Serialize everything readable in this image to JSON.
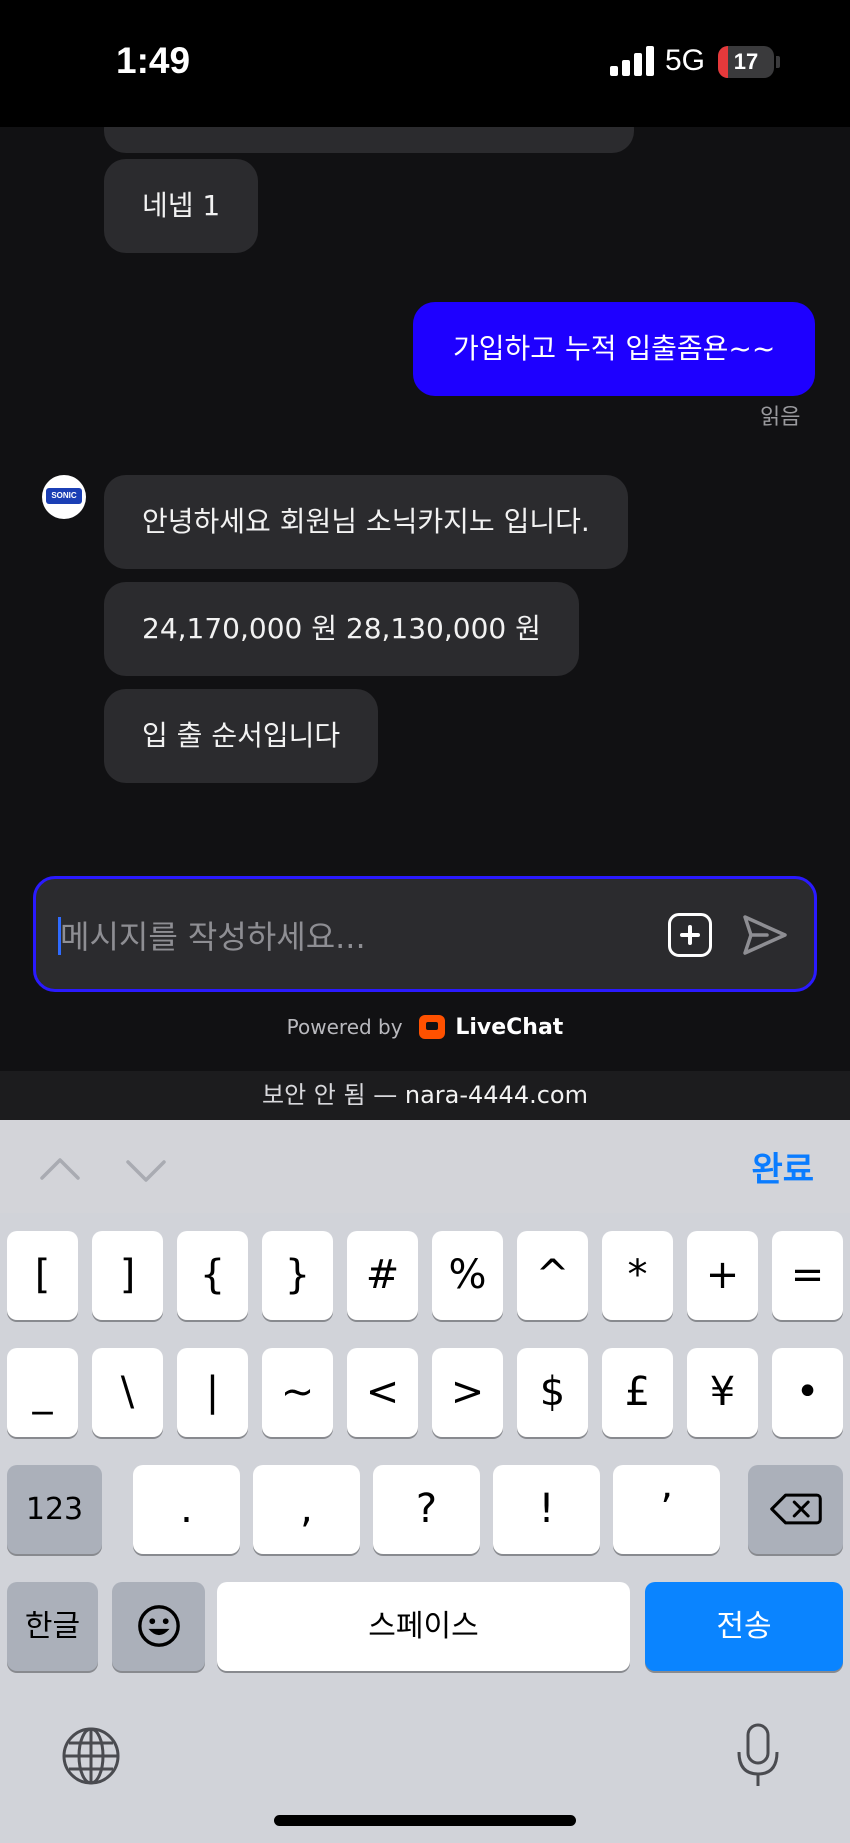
{
  "status_bar": {
    "time": "1:49",
    "network": "5G",
    "battery": "17",
    "battery_level": 0.17
  },
  "chat": {
    "messages": [
      {
        "from": "agent",
        "text": "네넵 1"
      },
      {
        "from": "user",
        "text": "가입하고 누적 입출좀욘~~"
      },
      {
        "from": "agent",
        "text": "안녕하세요 회원님 소닉카지노 입니다."
      },
      {
        "from": "agent",
        "text": "24,170,000 원 28,130,000 원"
      },
      {
        "from": "agent",
        "text": "입 출 순서입니다"
      }
    ],
    "read_status": "읽음",
    "avatar_text": "SONIC"
  },
  "composer": {
    "placeholder": "메시지를 작성하세요..."
  },
  "footer": {
    "powered_by": "Powered by",
    "brand": "LiveChat"
  },
  "url_bar": {
    "security": "보안 안 됨 —",
    "host": "nara-4444.com"
  },
  "keyboard": {
    "done": "완료",
    "row1": [
      "[",
      "]",
      "{",
      "}",
      "#",
      "%",
      "^",
      "*",
      "+",
      "="
    ],
    "row2": [
      "_",
      "\\",
      "|",
      "~",
      "<",
      ">",
      "$",
      "£",
      "¥",
      "•"
    ],
    "row3_mode": "123",
    "row3": [
      ".",
      ",",
      "?",
      "!",
      "’"
    ],
    "lang": "한글",
    "space": "스페이스",
    "send": "전송",
    "icons": [
      "chevron-up-icon",
      "chevron-down-icon",
      "backspace-icon",
      "emoji-icon",
      "globe-icon",
      "microphone-icon"
    ]
  }
}
